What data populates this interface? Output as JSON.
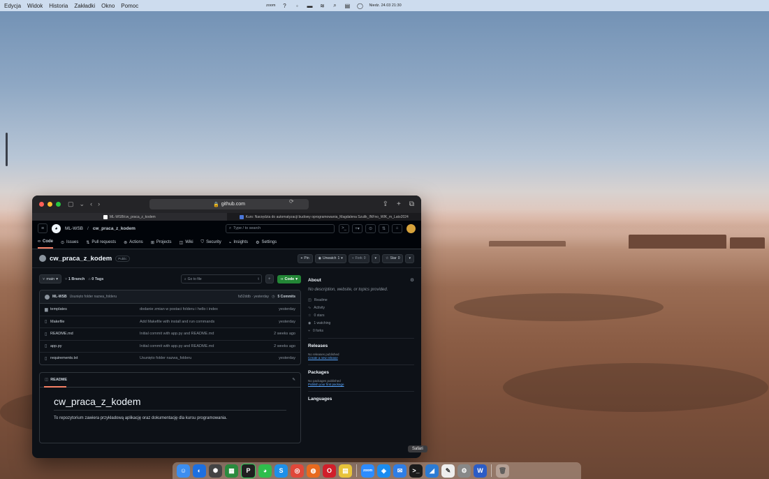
{
  "menubar": {
    "items": [
      "Edycja",
      "Widok",
      "Historia",
      "Zakładki",
      "Okno",
      "Pomoc"
    ],
    "zoom": "zoom",
    "datetime": "Niedz. 24.03 21:30"
  },
  "safari": {
    "url": "github.com",
    "tabs": [
      "ML-WSB/cw_praca_z_kodem",
      "Kurs: Narzędzia do automatyzacji budowy oprogramowania_Magdalena Szulik_INFno_WIK_m_Lato2024"
    ],
    "tooltip": "Safari"
  },
  "github": {
    "breadcrumb_owner": "ML-WSB",
    "breadcrumb_sep": "/",
    "breadcrumb_repo": "cw_praca_z_kodem",
    "search_placeholder": "Type / to search",
    "nav": [
      "Code",
      "Issues",
      "Pull requests",
      "Actions",
      "Projects",
      "Wiki",
      "Security",
      "Insights",
      "Settings"
    ],
    "repo_name": "cw_praca_z_kodem",
    "visibility": "Public",
    "actions": {
      "pin": "Pin",
      "unwatch": "Unwatch",
      "unwatch_count": "1",
      "fork": "Fork",
      "fork_count": "0",
      "star": "Star",
      "star_count": "0"
    },
    "branch": "main",
    "branches": "1 Branch",
    "tags": "0 Tags",
    "goto_file": "Go to file",
    "code_button": "Code",
    "latest_commit": {
      "author": "ML-WSB",
      "message": "Usunięto folder nazwa_folderu",
      "hash": "fa52ddb · yesterday",
      "commits": "5 Commits"
    },
    "files": [
      {
        "icon": "folder",
        "name": "templates",
        "message": "dodanie zmian w postaci folderu i hello i index",
        "time": "yesterday"
      },
      {
        "icon": "file",
        "name": "Makefile",
        "message": "Add Makefile with install and run commands",
        "time": "yesterday"
      },
      {
        "icon": "file",
        "name": "README.md",
        "message": "Initial commit with app.py and README.md",
        "time": "2 weeks ago"
      },
      {
        "icon": "file",
        "name": "app.py",
        "message": "Initial commit with app.py and README.md",
        "time": "2 weeks ago"
      },
      {
        "icon": "file",
        "name": "requirements.txt",
        "message": "Usunięto folder nazwa_folderu",
        "time": "yesterday"
      }
    ],
    "readme": {
      "tab": "README",
      "title": "cw_praca_z_kodem",
      "text": "To repozytorium zawiera przykładową aplikację oraz dokumentację dla kursu programowania."
    },
    "about": {
      "title": "About",
      "description": "No description, website, or topics provided.",
      "stats": [
        "Readme",
        "Activity",
        "0 stars",
        "1 watching",
        "0 forks"
      ]
    },
    "releases": {
      "title": "Releases",
      "none": "No releases published",
      "link": "Create a new release"
    },
    "packages": {
      "title": "Packages",
      "none": "No packages published",
      "link": "Publish your first package"
    },
    "languages": {
      "title": "Languages"
    }
  }
}
